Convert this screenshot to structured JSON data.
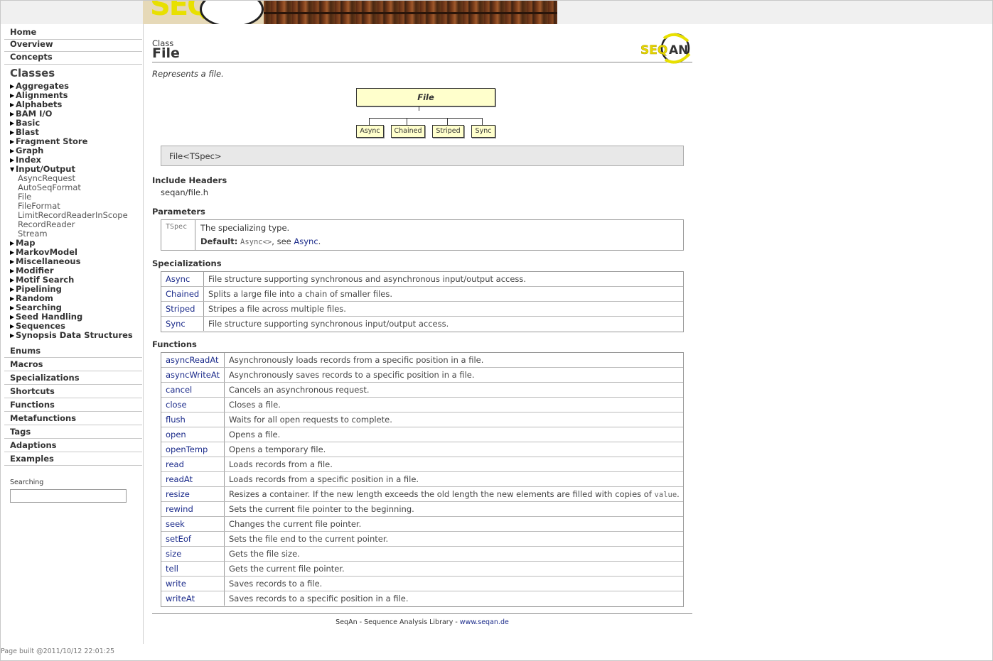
{
  "banner": {
    "logo_text": "SEQ"
  },
  "sidebar": {
    "top_links": [
      "Home",
      "Overview",
      "Concepts"
    ],
    "classes_title": "Classes",
    "categories_before": [
      "Aggregates",
      "Alignments",
      "Alphabets",
      "BAM I/O",
      "Basic",
      "Blast",
      "Fragment Store",
      "Graph",
      "Index"
    ],
    "open_category": "Input/Output",
    "open_items": [
      "AsyncRequest",
      "AutoSeqFormat",
      "File",
      "FileFormat",
      "LimitRecordReaderInScope",
      "RecordReader",
      "Stream"
    ],
    "categories_after": [
      "Map",
      "MarkovModel",
      "Miscellaneous",
      "Modifier",
      "Motif Search",
      "Pipelining",
      "Random",
      "Searching",
      "Seed Handling",
      "Sequences",
      "Synopsis Data Structures"
    ],
    "bottom_links": [
      "Enums",
      "Macros",
      "Specializations",
      "Shortcuts",
      "Functions",
      "Metafunctions",
      "Tags",
      "Adaptions",
      "Examples"
    ],
    "search_label": "Searching",
    "search_value": ""
  },
  "page_built": "Page built @2011/10/12 22:01:25",
  "header": {
    "kind": "Class",
    "title": "File",
    "description": "Represents a file.",
    "logo_text": "SEQAN"
  },
  "diagram": {
    "root": "File",
    "children": [
      "Async",
      "Chained",
      "Striped",
      "Sync"
    ]
  },
  "signature": "File<TSpec>",
  "include": {
    "heading": "Include Headers",
    "value": "seqan/file.h"
  },
  "parameters": {
    "heading": "Parameters",
    "name": "TSpec",
    "desc": "The specializing type.",
    "default_label": "Default:",
    "default_value": "Async<>",
    "see_text": ", see",
    "see_link": "Async",
    "period": "."
  },
  "specializations": {
    "heading": "Specializations",
    "rows": [
      {
        "name": "Async",
        "desc": "File structure supporting synchronous and asynchronous input/output access."
      },
      {
        "name": "Chained",
        "desc": "Splits a large file into a chain of smaller files."
      },
      {
        "name": "Striped",
        "desc": "Stripes a file across multiple files."
      },
      {
        "name": "Sync",
        "desc": "File structure supporting synchronous input/output access."
      }
    ]
  },
  "functions": {
    "heading": "Functions",
    "rows": [
      {
        "name": "asyncReadAt",
        "desc": "Asynchronously loads records from a specific position in a file."
      },
      {
        "name": "asyncWriteAt",
        "desc": "Asynchronously saves records to a specific position in a file."
      },
      {
        "name": "cancel",
        "desc": "Cancels an asynchronous request."
      },
      {
        "name": "close",
        "desc": "Closes a file."
      },
      {
        "name": "flush",
        "desc": "Waits for all open requests to complete."
      },
      {
        "name": "open",
        "desc": "Opens a file."
      },
      {
        "name": "openTemp",
        "desc": "Opens a temporary file."
      },
      {
        "name": "read",
        "desc": "Loads records from a file."
      },
      {
        "name": "readAt",
        "desc": "Loads records from a specific position in a file."
      },
      {
        "name": "resize",
        "desc": "Resizes a container. If the new length exceeds the old length the new elements are filled with copies of",
        "code": "value",
        "tail": "."
      },
      {
        "name": "rewind",
        "desc": "Sets the current file pointer to the beginning."
      },
      {
        "name": "seek",
        "desc": "Changes the current file pointer."
      },
      {
        "name": "setEof",
        "desc": "Sets the file end to the current pointer."
      },
      {
        "name": "size",
        "desc": "Gets the file size."
      },
      {
        "name": "tell",
        "desc": "Gets the current file pointer."
      },
      {
        "name": "write",
        "desc": "Saves records to a file."
      },
      {
        "name": "writeAt",
        "desc": "Saves records to a specific position in a file."
      }
    ]
  },
  "footer": {
    "text": "SeqAn - Sequence Analysis Library - ",
    "link": "www.seqan.de"
  }
}
